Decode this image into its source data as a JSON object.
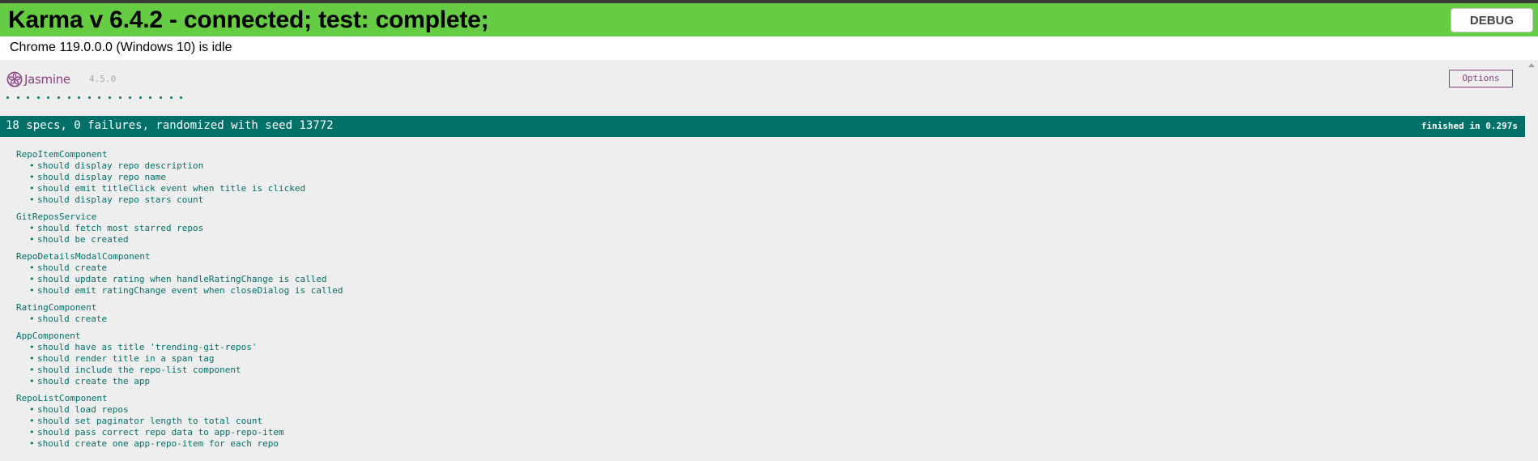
{
  "banner": {
    "title": "Karma v 6.4.2 - connected; test: complete;",
    "debug_label": "DEBUG",
    "color": "#66cc44"
  },
  "browser": {
    "status": "Chrome 119.0.0.0 (Windows 10) is idle"
  },
  "jasmine": {
    "logo_text": "Jasmine",
    "version": "4.5.0",
    "options_label": "Options",
    "dot_count": 18,
    "summary": "18 specs, 0 failures, randomized with seed 13772",
    "duration": "finished in 0.297s",
    "accent": "#8a4182",
    "pass_color": "#007069"
  },
  "suites": [
    {
      "name": "RepoItemComponent",
      "specs": [
        "should display repo description",
        "should display repo name",
        "should emit titleClick event when title is clicked",
        "should display repo stars count"
      ]
    },
    {
      "name": "GitReposService",
      "specs": [
        "should fetch most starred repos",
        "should be created"
      ]
    },
    {
      "name": "RepoDetailsModalComponent",
      "specs": [
        "should create",
        "should update rating when handleRatingChange is called",
        "should emit ratingChange event when closeDialog is called"
      ]
    },
    {
      "name": "RatingComponent",
      "specs": [
        "should create"
      ]
    },
    {
      "name": "AppComponent",
      "specs": [
        "should have as title 'trending-git-repos'",
        "should render title in a span tag",
        "should include the repo-list component",
        "should create the app"
      ]
    },
    {
      "name": "RepoListComponent",
      "specs": [
        "should load repos",
        "should set paginator length to total count",
        "should pass correct repo data to app-repo-item",
        "should create one app-repo-item for each repo"
      ]
    }
  ]
}
